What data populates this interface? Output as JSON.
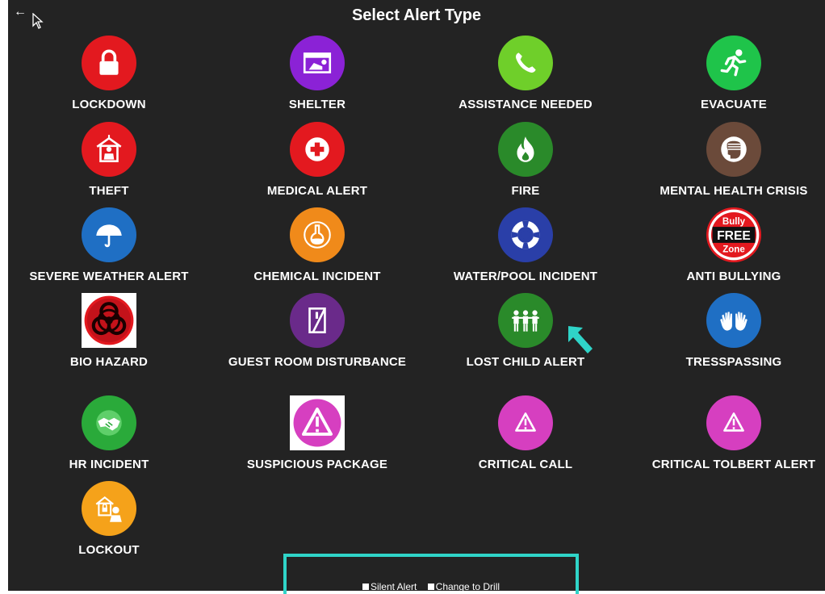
{
  "header": {
    "title": "Select Alert Type",
    "back_icon": "arrow-left-icon"
  },
  "colors": {
    "background": "#232323",
    "accent": "#2fd4c8",
    "red": "#e3191f",
    "purple": "#8b22d6",
    "lime": "#6fcf2a",
    "green": "#1fc44a",
    "brown": "#6b4a3a",
    "darkgreen": "#2a8a2a",
    "blue": "#1f6fc4",
    "navy": "#2a3fa8",
    "orange": "#f08a1a",
    "magenta": "#d63fc0",
    "amber": "#f5a21a"
  },
  "alerts": [
    {
      "label": "LOCKDOWN",
      "icon": "padlock-icon"
    },
    {
      "label": "SHELTER",
      "icon": "shelter-icon"
    },
    {
      "label": "ASSISTANCE NEEDED",
      "icon": "phone-icon"
    },
    {
      "label": "EVACUATE",
      "icon": "running-person-icon"
    },
    {
      "label": "THEFT",
      "icon": "burglar-house-icon"
    },
    {
      "label": "MEDICAL ALERT",
      "icon": "medical-cross-icon"
    },
    {
      "label": "FIRE",
      "icon": "flame-icon"
    },
    {
      "label": "MENTAL HEALTH CRISIS",
      "icon": "head-bandage-icon"
    },
    {
      "label": "SEVERE WEATHER ALERT",
      "icon": "umbrella-icon"
    },
    {
      "label": "CHEMICAL INCIDENT",
      "icon": "flask-icon"
    },
    {
      "label": "WATER/POOL INCIDENT",
      "icon": "life-ring-icon"
    },
    {
      "label": "ANTI BULLYING",
      "icon": "bully-free-zone-icon",
      "badge": [
        "Bully",
        "FREE",
        "Zone"
      ]
    },
    {
      "label": "BIO HAZARD",
      "icon": "biohazard-icon"
    },
    {
      "label": "GUEST ROOM DISTURBANCE",
      "icon": "door-icon"
    },
    {
      "label": "LOST CHILD ALERT",
      "icon": "children-group-icon"
    },
    {
      "label": "TRESSPASSING",
      "icon": "raised-hands-icon"
    },
    {
      "label": "HR INCIDENT",
      "icon": "handshake-icon"
    },
    {
      "label": "SUSPICIOUS PACKAGE",
      "icon": "warning-triangle-icon"
    },
    {
      "label": "CRITICAL CALL",
      "icon": "warning-triangle-icon"
    },
    {
      "label": "CRITICAL TOLBERT ALERT",
      "icon": "warning-triangle-icon"
    },
    {
      "label": "LOCKOUT",
      "icon": "lockout-icon"
    }
  ],
  "footer": {
    "silent_alert": "Silent Alert",
    "change_to_drill": "Change to Drill"
  }
}
